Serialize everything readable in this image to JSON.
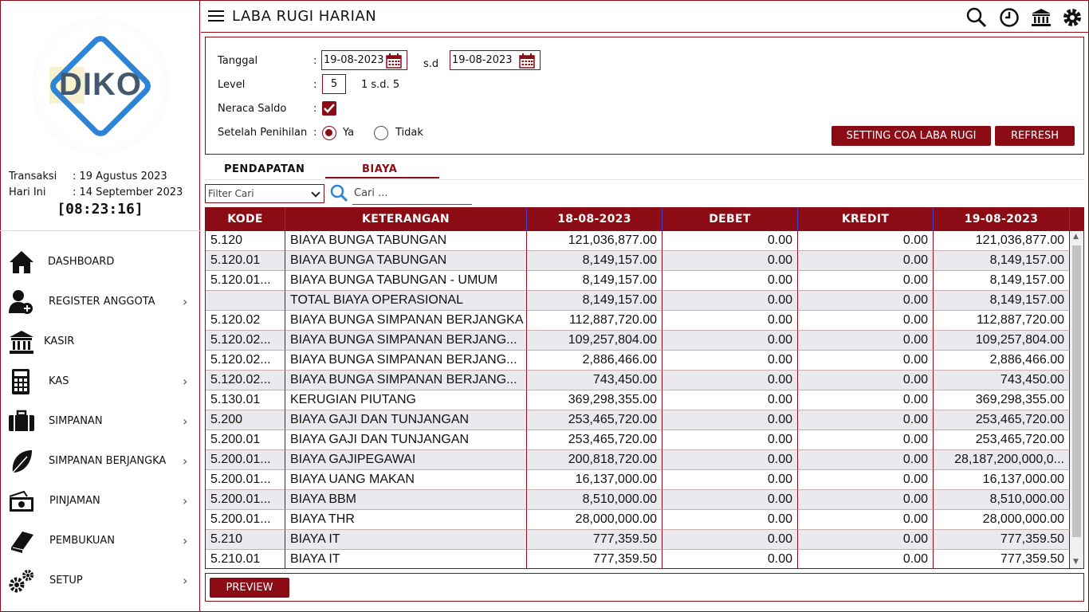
{
  "sidebar": {
    "logo_text": "DIKO",
    "transaksi_label": "Transaksi",
    "transaksi_value": ": 19 Agustus 2023",
    "hari_ini_label": "Hari Ini",
    "hari_ini_value": ": 14 September 2023",
    "clock": "[08:23:16]",
    "menu": [
      {
        "label": "DASHBOARD",
        "icon": "home-icon",
        "has_submenu": false
      },
      {
        "label": "REGISTER ANGGOTA",
        "icon": "add-user-icon",
        "has_submenu": true
      },
      {
        "label": "KASIR",
        "icon": "bank-icon",
        "has_submenu": false
      },
      {
        "label": "KAS",
        "icon": "calculator-icon",
        "has_submenu": true
      },
      {
        "label": "SIMPANAN",
        "icon": "briefcase-icon",
        "has_submenu": true
      },
      {
        "label": "SIMPANAN BERJANGKA",
        "icon": "leaf-icon",
        "has_submenu": true
      },
      {
        "label": "PINJAMAN",
        "icon": "money-icon",
        "has_submenu": true
      },
      {
        "label": "PEMBUKUAN",
        "icon": "book-icon",
        "has_submenu": true
      },
      {
        "label": "SETUP",
        "icon": "gears-icon",
        "has_submenu": true
      }
    ]
  },
  "header": {
    "title": "LABA RUGI HARIAN",
    "icons": [
      "search-icon",
      "clock-icon",
      "bank-icon",
      "gear-icon"
    ]
  },
  "form": {
    "tanggal_label": "Tanggal",
    "colon": ":",
    "date_from": "19-08-2023",
    "sd_label": "s.d",
    "date_to": "19-08-2023",
    "level_label": "Level",
    "level_value": "5",
    "level_hint": "1 s.d. 5",
    "neraca_label": "Neraca Saldo",
    "neraca_checked": true,
    "penihilan_label": "Setelah Penihilan",
    "radio_ya": "Ya",
    "radio_tidak": "Tidak",
    "selected": "Ya",
    "btn_setting": "SETTING COA LABA RUGI",
    "btn_refresh": "REFRESH"
  },
  "tabs": [
    {
      "label": "PENDAPATAN",
      "active": false
    },
    {
      "label": "BIAYA",
      "active": true
    }
  ],
  "filter": {
    "select_value": "Filter Cari",
    "search_placeholder": "Cari ..."
  },
  "table": {
    "columns": [
      "KODE",
      "KETERANGAN",
      "18-08-2023",
      "DEBET",
      "KREDIT",
      "19-08-2023"
    ],
    "rows": [
      [
        "5.120",
        "BIAYA BUNGA TABUNGAN",
        "121,036,877.00",
        "0.00",
        "0.00",
        "121,036,877.00"
      ],
      [
        "5.120.01",
        "BIAYA BUNGA TABUNGAN",
        "8,149,157.00",
        "0.00",
        "0.00",
        "8,149,157.00"
      ],
      [
        "5.120.01...",
        "BIAYA BUNGA TABUNGAN - UMUM",
        "8,149,157.00",
        "0.00",
        "0.00",
        "8,149,157.00"
      ],
      [
        "",
        "TOTAL BIAYA OPERASIONAL",
        "8,149,157.00",
        "0.00",
        "0.00",
        "8,149,157.00"
      ],
      [
        "5.120.02",
        "BIAYA BUNGA SIMPANAN BERJANGKA",
        "112,887,720.00",
        "0.00",
        "0.00",
        "112,887,720.00"
      ],
      [
        "5.120.02...",
        "BIAYA BUNGA SIMPANAN BERJANG...",
        "109,257,804.00",
        "0.00",
        "0.00",
        "109,257,804.00"
      ],
      [
        "5.120.02...",
        "BIAYA BUNGA SIMPANAN BERJANG...",
        "2,886,466.00",
        "0.00",
        "0.00",
        "2,886,466.00"
      ],
      [
        "5.120.02...",
        "BIAYA BUNGA SIMPANAN BERJANG...",
        "743,450.00",
        "0.00",
        "0.00",
        "743,450.00"
      ],
      [
        "5.130.01",
        "KERUGIAN PIUTANG",
        "369,298,355.00",
        "0.00",
        "0.00",
        "369,298,355.00"
      ],
      [
        "5.200",
        "BIAYA GAJI DAN TUNJANGAN",
        "253,465,720.00",
        "0.00",
        "0.00",
        "253,465,720.00"
      ],
      [
        "5.200.01",
        "BIAYA GAJI DAN TUNJANGAN",
        "253,465,720.00",
        "0.00",
        "0.00",
        "253,465,720.00"
      ],
      [
        "5.200.01...",
        "BIAYA GAJIPEGAWAI",
        "200,818,720.00",
        "0.00",
        "0.00",
        "28,187,200,000,0..."
      ],
      [
        "5.200.01...",
        "BIAYA UANG MAKAN",
        "16,137,000.00",
        "0.00",
        "0.00",
        "16,137,000.00"
      ],
      [
        "5.200.01...",
        "BIAYA BBM",
        "8,510,000.00",
        "0.00",
        "0.00",
        "8,510,000.00"
      ],
      [
        "5.200.01...",
        "BIAYA THR",
        "28,000,000.00",
        "0.00",
        "0.00",
        "28,000,000.00"
      ],
      [
        "5.210",
        "BIAYA IT",
        "777,359.50",
        "0.00",
        "0.00",
        "777,359.50"
      ],
      [
        "5.210.01",
        "BIAYA IT",
        "777,359.50",
        "0.00",
        "0.00",
        "777,359.50"
      ]
    ]
  },
  "footer": {
    "btn_preview": "PREVIEW"
  },
  "colors": {
    "accent": "#8b0c14",
    "row_alt": "#e9e9ee",
    "logo_blue": "#2d83d6"
  }
}
